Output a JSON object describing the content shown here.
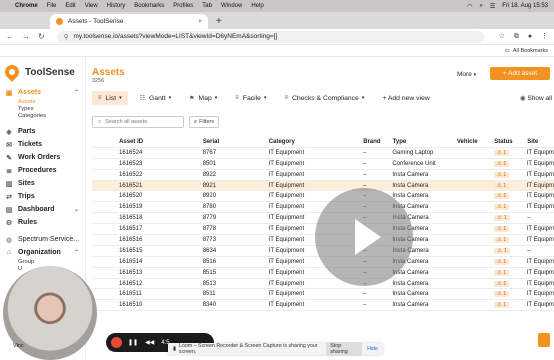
{
  "mac_menu": {
    "apple": "",
    "items": [
      "Chrome",
      "File",
      "Edit",
      "View",
      "History",
      "Bookmarks",
      "Profiles",
      "Tab",
      "Window",
      "Help"
    ],
    "clock": "Fri 18. Aug 15:53"
  },
  "tab": {
    "title": "Assets - ToolSense"
  },
  "url": {
    "value": "my.toolsense.io/assets?viewMode=LIST&viewId=D6yNEmA&sorting=[]"
  },
  "bookmarks": {
    "label": "All Bookmarks"
  },
  "sidebar": {
    "logo": "ToolSense",
    "items": [
      {
        "label": "Assets",
        "icon": "box-icon"
      },
      {
        "label": "Parts",
        "icon": "cube-icon"
      },
      {
        "label": "Tickets",
        "icon": "ticket-icon"
      },
      {
        "label": "Work Orders",
        "icon": "wrench-icon"
      },
      {
        "label": "Procedures",
        "icon": "list-icon"
      },
      {
        "label": "Sites",
        "icon": "building-icon"
      },
      {
        "label": "Trips",
        "icon": "route-icon"
      },
      {
        "label": "Dashboard",
        "icon": "chart-icon"
      },
      {
        "label": "Rules",
        "icon": "rules-icon"
      },
      {
        "label": "Spectrum Service...",
        "icon": "globe-icon"
      },
      {
        "label": "Organization",
        "icon": "org-icon"
      }
    ],
    "assets_sub": [
      "Assets",
      "Types",
      "Categories"
    ],
    "org_sub": [
      "Group",
      "U"
    ],
    "user_name": "Vinc"
  },
  "header": {
    "title": "Assets",
    "count": "3256",
    "more": "More",
    "add": "+ Add asset"
  },
  "views": [
    {
      "label": "List",
      "icon": "list-icon"
    },
    {
      "label": "Gantt",
      "icon": "gantt-icon"
    },
    {
      "label": "Map",
      "icon": "map-icon"
    },
    {
      "label": "Facile",
      "icon": "facile-icon"
    },
    {
      "label": "Checks & Compliance",
      "icon": "check-icon"
    },
    {
      "label": "+ Add new view",
      "icon": "plus-icon"
    }
  ],
  "show_all": "Show all",
  "search": {
    "placeholder": "Search all assets"
  },
  "filters": "Filters",
  "table": {
    "columns": [
      "Asset ID",
      "Serial",
      "Category",
      "Brand",
      "Type",
      "Vehicle",
      "Status",
      "Site"
    ],
    "rows": [
      [
        "1616524",
        "8767",
        "IT Equipment",
        "–",
        "Gaming Laptop",
        "",
        "1",
        "IT Equipm"
      ],
      [
        "1616523",
        "8501",
        "IT Equipment",
        "–",
        "Conference Unit",
        "",
        "1",
        "IT Equipm"
      ],
      [
        "1616522",
        "8922",
        "IT Equipment",
        "–",
        "Insta Camera",
        "",
        "1",
        "IT Equipm"
      ],
      [
        "1616521",
        "8921",
        "IT Equipment",
        "–",
        "Insta Camera",
        "",
        "1",
        "IT Equipm"
      ],
      [
        "1616520",
        "8920",
        "IT Equipment",
        "–",
        "Insta Camera",
        "",
        "1",
        "IT Equipm"
      ],
      [
        "1616519",
        "8780",
        "IT Equipment",
        "–",
        "Insta Camera",
        "",
        "1",
        "IT Equipm"
      ],
      [
        "1616518",
        "8779",
        "IT Equipment",
        "–",
        "Insta Camera",
        "",
        "1",
        "–"
      ],
      [
        "1616517",
        "8778",
        "IT Equipment",
        "–",
        "Insta Camera",
        "",
        "1",
        "IT Equipm"
      ],
      [
        "1616516",
        "8773",
        "IT Equipment",
        "–",
        "Insta Camera",
        "",
        "1",
        "IT Equipm"
      ],
      [
        "1616515",
        "8634",
        "IT Equipment",
        "–",
        "Insta Camera",
        "",
        "1",
        "–"
      ],
      [
        "1616514",
        "8516",
        "IT Equipment",
        "–",
        "Insta Camera",
        "",
        "1",
        "IT Equipm"
      ],
      [
        "1616513",
        "8515",
        "IT Equipment",
        "–",
        "Insta Camera",
        "",
        "1",
        "IT Equipm"
      ],
      [
        "1616512",
        "8513",
        "IT Equipment",
        "–",
        "Insta Camera",
        "",
        "1",
        "IT Equipm"
      ],
      [
        "1616511",
        "8511",
        "IT Equipment",
        "–",
        "Insta Camera",
        "",
        "1",
        "IT Equipm"
      ],
      [
        "1616510",
        "8340",
        "IT Equipment",
        "–",
        "Insta Camera",
        "",
        "1",
        "IT Equipm"
      ]
    ]
  },
  "loom": {
    "time": "4:5"
  },
  "share_notice": {
    "text": "Loom – Screen Recorder & Screen Capture is sharing your screen.",
    "stop": "Stop sharing",
    "hide": "Hide"
  },
  "colors": {
    "accent": "#f29222",
    "highlight_row": "#fdeed9"
  }
}
